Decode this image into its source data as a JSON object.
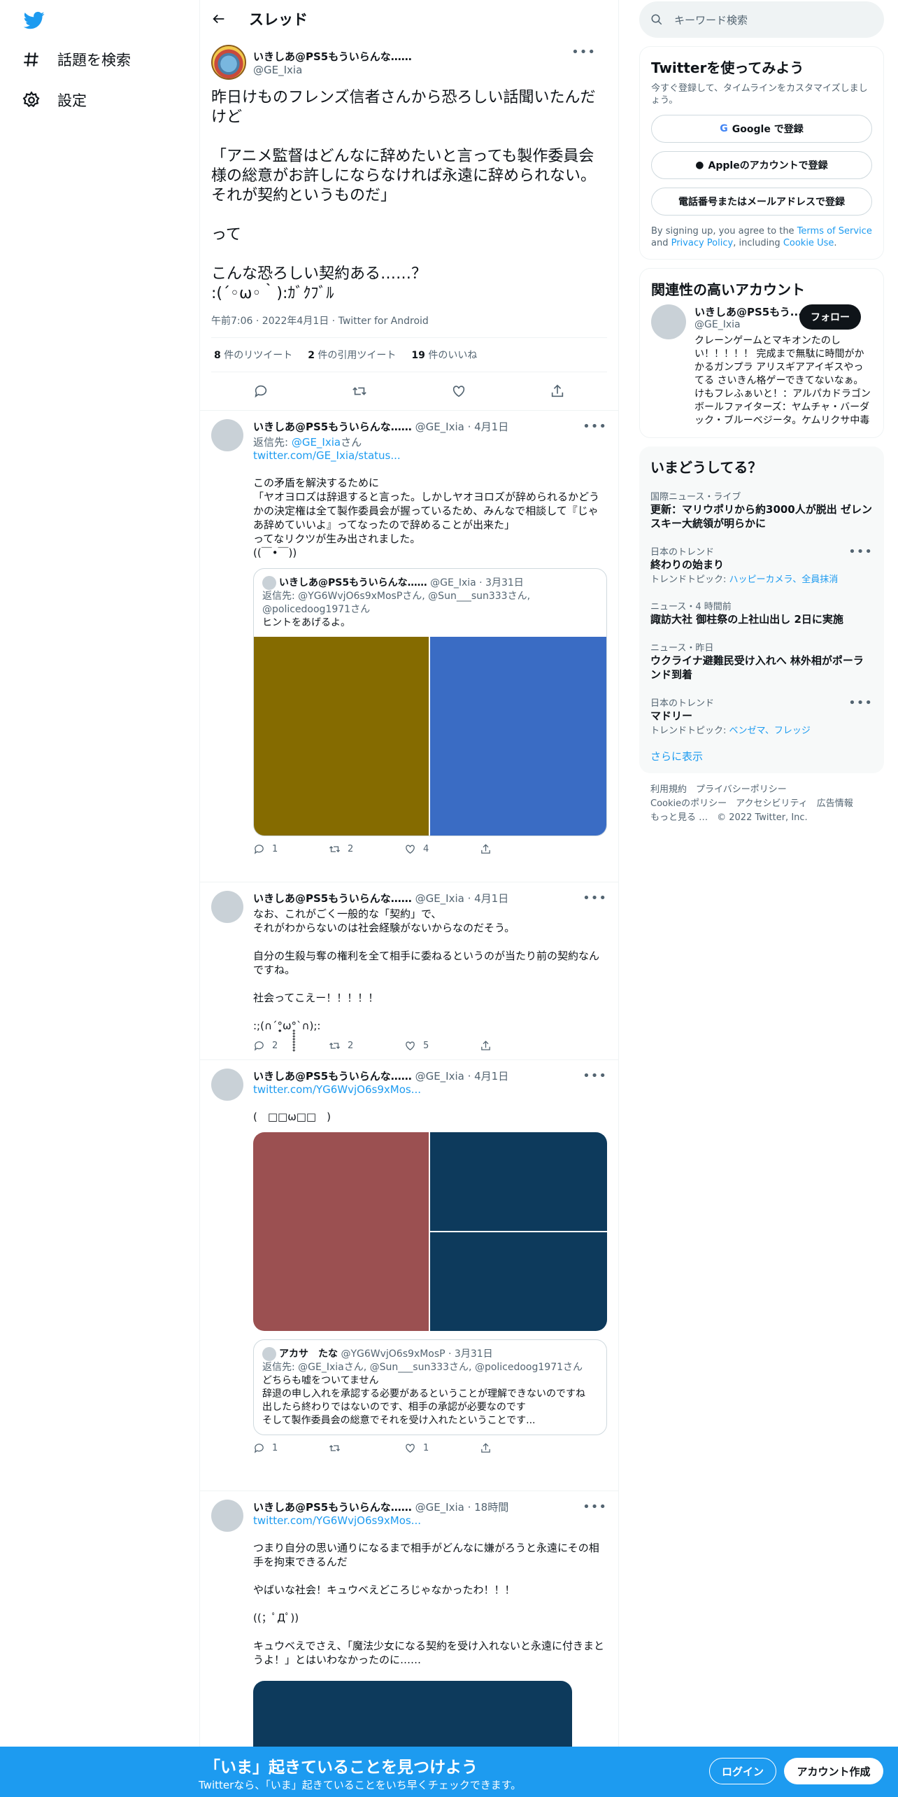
{
  "nav": {
    "explore": "話題を検索",
    "settings": "設定"
  },
  "header": {
    "title": "スレッド"
  },
  "main_tweet": {
    "name": "いきしあ@PS5もういらんな……",
    "handle": "@GE_Ixia",
    "text": "昨日けものフレンズ信者さんから恐ろしい話聞いたんだけど\n\n「アニメ監督はどんなに辞めたいと言っても製作委員会様の総意がお許しにならなければ永遠に辞められない。それが契約というものだ」\n\nって\n\nこんな恐ろしい契約ある……？\n:(´◦ω◦｀):ｶﾞｸﾌﾞﾙ",
    "meta": "午前7:06 · 2022年4月1日 · Twitter for Android",
    "retweets_count": "8",
    "retweets_label": " 件のリツイート",
    "quotes_count": "2",
    "quotes_label": " 件の引用ツイート",
    "likes_count": "19",
    "likes_label": " 件のいいね"
  },
  "replies": [
    {
      "name": "いきしあ@PS5もういらんな……",
      "handle_date": "@GE_Ixia · 4月1日",
      "reply_to_prefix": "返信先: ",
      "reply_to_user": "@GE_Ixia",
      "reply_to_suffix": "さん",
      "link": "twitter.com/GE_Ixia/status...",
      "text": "この矛盾を解決するために\n「ヤオヨロズは辞退すると言った。しかしヤオヨロズが辞められるかどうかの決定権は全て製作委員会が握っているため、みんなで相談して『じゃあ辞めていいよ』ってなったので辞めることが出来た」\nってなリクツが生み出されました。\n((￣•￣))",
      "quote": {
        "name": "いきしあ@PS5もういらんな……",
        "handle_date": "@GE_Ixia · 3月31日",
        "reply_to": "返信先: @YG6WvjO6s9xMosPさん, @Sun___sun333さん, @policedoog1971さん",
        "text": "ヒントをあげるよ。"
      },
      "counts": {
        "reply": "1",
        "retweet": "2",
        "like": "4"
      }
    },
    {
      "name": "いきしあ@PS5もういらんな……",
      "handle_date": "@GE_Ixia · 4月1日",
      "text": "なお、これがごく一般的な「契約」で、\nそれがわからないのは社会経験がないからなのだそう。\n\n自分の生殺与奪の権利を全て相手に委ねるというのが当たり前の契約なんですね。\n\n社会ってこえー！！！！！\n\n:;(∩´°̥̥̥̥̥̥̥̥ω°̥̥̥̥̥̥̥̥`∩);:",
      "counts": {
        "reply": "2",
        "retweet": "2",
        "like": "5"
      }
    },
    {
      "name": "いきしあ@PS5もういらんな……",
      "handle_date": "@GE_Ixia · 4月1日",
      "link": "twitter.com/YG6WvjO6s9xMos...",
      "text": "(　□□ω□□　)",
      "quote": {
        "name": "アカサ　たな",
        "handle_date": "@YG6WvjO6s9xMosP · 3月31日",
        "reply_to": "返信先: @GE_Ixiaさん, @Sun___sun333さん, @policedoog1971さん",
        "text": "どちらも嘘をついてません\n辞退の申し入れを承認する必要があるということが理解できないのですね\n出したら終わりではないのです、相手の承認が必要なのです\nそして製作委員会の総意でそれを受け入れたということです..."
      },
      "counts": {
        "reply": "1",
        "retweet": "",
        "like": "1"
      }
    },
    {
      "name": "いきしあ@PS5もういらんな……",
      "handle_date": "@GE_Ixia · 18時間",
      "link": "twitter.com/YG6WvjO6s9xMos...",
      "text": "つまり自分の思い通りになるまで相手がどんなに嫌がろうと永遠にその相手を拘束できるんだ\n\nやばいな社会！キュウベえどころじゃなかったわ！！！\n\n((；ﾟДﾟ))\n\nキュウベえでさえ、「魔法少女になる契約を受け入れないと永遠に付きまとうよ！」とはいわなかったのに……"
    }
  ],
  "right": {
    "search_placeholder": "キーワード検索",
    "signup": {
      "title": "Twitterを使ってみよう",
      "desc": "今すぐ登録して、タイムラインをカスタマイズしましょう。",
      "google": "Google で登録",
      "apple": "Appleのアカウントで登録",
      "phone": "電話番号またはメールアドレスで登録",
      "terms_prefix": "By signing up, you agree to the ",
      "terms_tos": "Terms of Service",
      "terms_and": " and ",
      "terms_pp": "Privacy Policy",
      "terms_including": ", including ",
      "terms_cookie": "Cookie Use",
      "terms_end": "."
    },
    "related": {
      "title": "関連性の高いアカウント",
      "name": "いきしあ@PS5もう...",
      "handle": "@GE_Ixia",
      "follow": "フォロー",
      "bio": "クレーンゲームとマキオンたのしい！！！！！ 完成まで無駄に時間がかかるガンプラ アリスギアアイギスやってる さいきん格ゲーできてないなぁ。けもフレふぁいと！：アルパカドラゴンボールファイターズ：ヤムチャ・バーダック・ブルーベジータ。ケムリクサ中毒"
    },
    "trends": {
      "title": "いまどうしてる？",
      "items": [
        {
          "cat": "国際ニュース・ライブ",
          "title": "更新：マリウポリから約3000人が脱出 ゼレンスキー大統領が明らかに",
          "topics_label": "",
          "topics": ""
        },
        {
          "cat": "日本のトレンド",
          "title": "終わりの始まり",
          "topics_label": "トレンドトピック: ",
          "topics": "ハッピーカメラ、全員抹消"
        },
        {
          "cat": "ニュース・4 時間前",
          "title": "諏訪大社 御柱祭の上社山出し 2日に実施",
          "topics_label": "",
          "topics": ""
        },
        {
          "cat": "ニュース・昨日",
          "title": "ウクライナ避難民受け入れへ 林外相がポーランド到着",
          "topics_label": "",
          "topics": ""
        },
        {
          "cat": "日本のトレンド",
          "title": "マドリー",
          "topics_label": "トレンドトピック: ",
          "topics": "ベンゼマ、フレッジ"
        }
      ],
      "show_more": "さらに表示"
    },
    "footer": {
      "l1": "利用規約　プライバシーポリシー",
      "l2": "Cookieのポリシー　アクセシビリティ　広告情報",
      "l3": "もっと見る …　© 2022 Twitter, Inc."
    }
  },
  "bottom_bar": {
    "headline": "「いま」起きていることを見つけよう",
    "sub": "Twitterなら、「いま」起きていることをいち早くチェックできます。",
    "login": "ログイン",
    "signup": "アカウント作成"
  },
  "colors": {
    "twitter_blue": "#1d9bf0",
    "img1_left": "#856b00",
    "img1_right": "#3a6cc4",
    "img2_left": "#9b5051",
    "img2_right": "#0d3a5c"
  }
}
